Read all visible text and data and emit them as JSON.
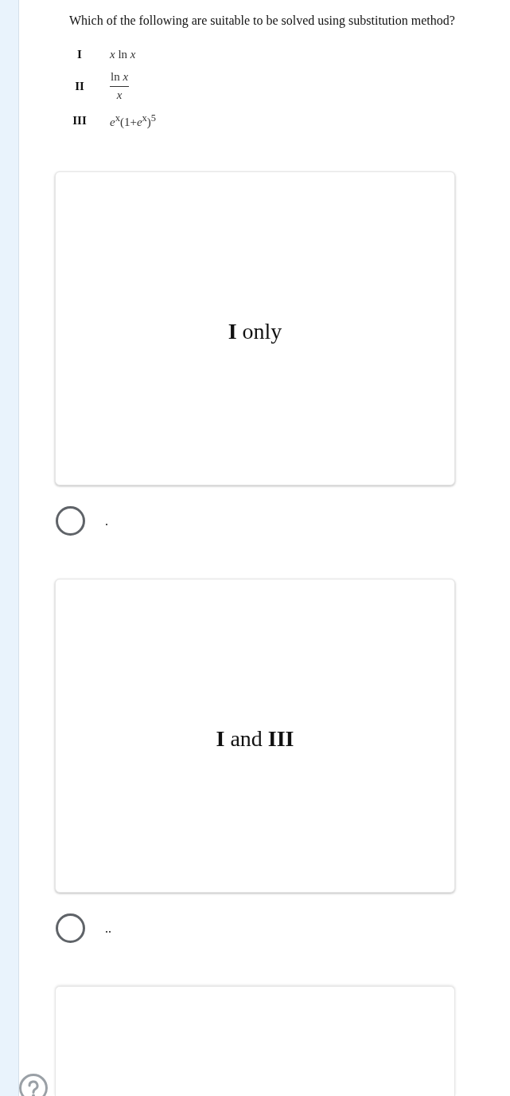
{
  "question": {
    "text": "Which of the following are suitable to be solved using substitution method?",
    "statements": [
      {
        "label": "I",
        "kind": "inline",
        "expr": "*x* ln *x*"
      },
      {
        "label": "II",
        "kind": "fraction",
        "numerator": "ln *x*",
        "denominator": "*x*"
      },
      {
        "label": "III",
        "kind": "inline",
        "expr": "*e*$^{x}$(1+*e*$^{x}$)$^{5}$"
      }
    ]
  },
  "answers": [
    {
      "kind": "card",
      "text": "**I** only"
    },
    {
      "kind": "radio",
      "label": ".",
      "selected": false
    },
    {
      "kind": "card",
      "text": "**I** and **III**"
    },
    {
      "kind": "radio",
      "label": "..",
      "selected": false
    },
    {
      "kind": "card"
    }
  ]
}
